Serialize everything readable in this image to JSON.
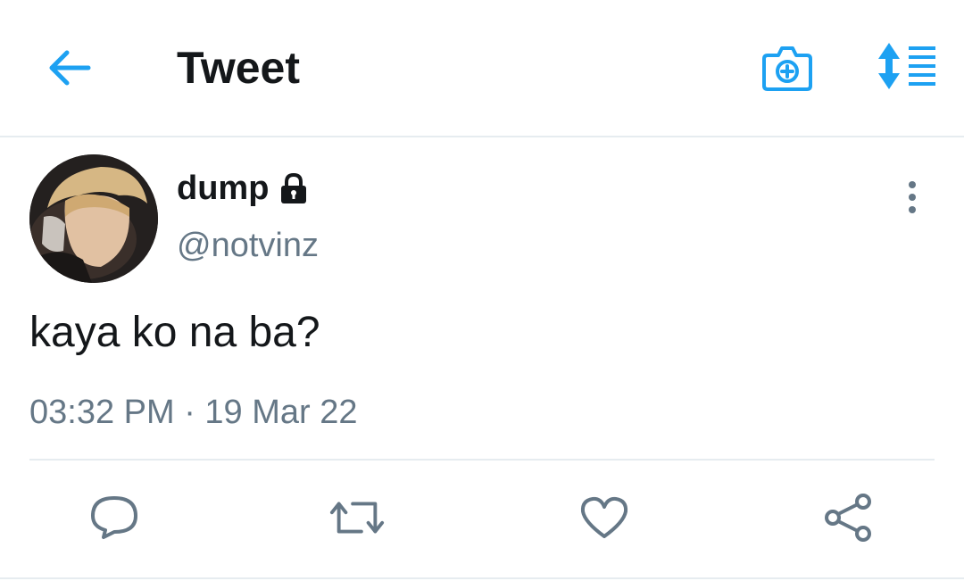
{
  "header": {
    "title": "Tweet",
    "back_icon": "arrow-left-icon",
    "camera_icon": "camera-plus-icon",
    "sort_icon": "sort-list-icon",
    "accent": "#1da1f2"
  },
  "tweet": {
    "display_name": "dump",
    "handle": "@notvinz",
    "text": "kaya ko na ba?",
    "timestamp": "03:32 PM · 19 Mar 22",
    "protected_icon": "lock-icon",
    "more_icon": "more-vertical-icon"
  },
  "actions": [
    {
      "name": "reply",
      "icon": "reply-icon"
    },
    {
      "name": "retweet",
      "icon": "retweet-icon"
    },
    {
      "name": "like",
      "icon": "heart-icon"
    },
    {
      "name": "share",
      "icon": "share-icon"
    }
  ],
  "colors": {
    "text": "#14171a",
    "secondary": "#657786",
    "icon_gray": "#657786",
    "divider": "#e6ecf0"
  }
}
